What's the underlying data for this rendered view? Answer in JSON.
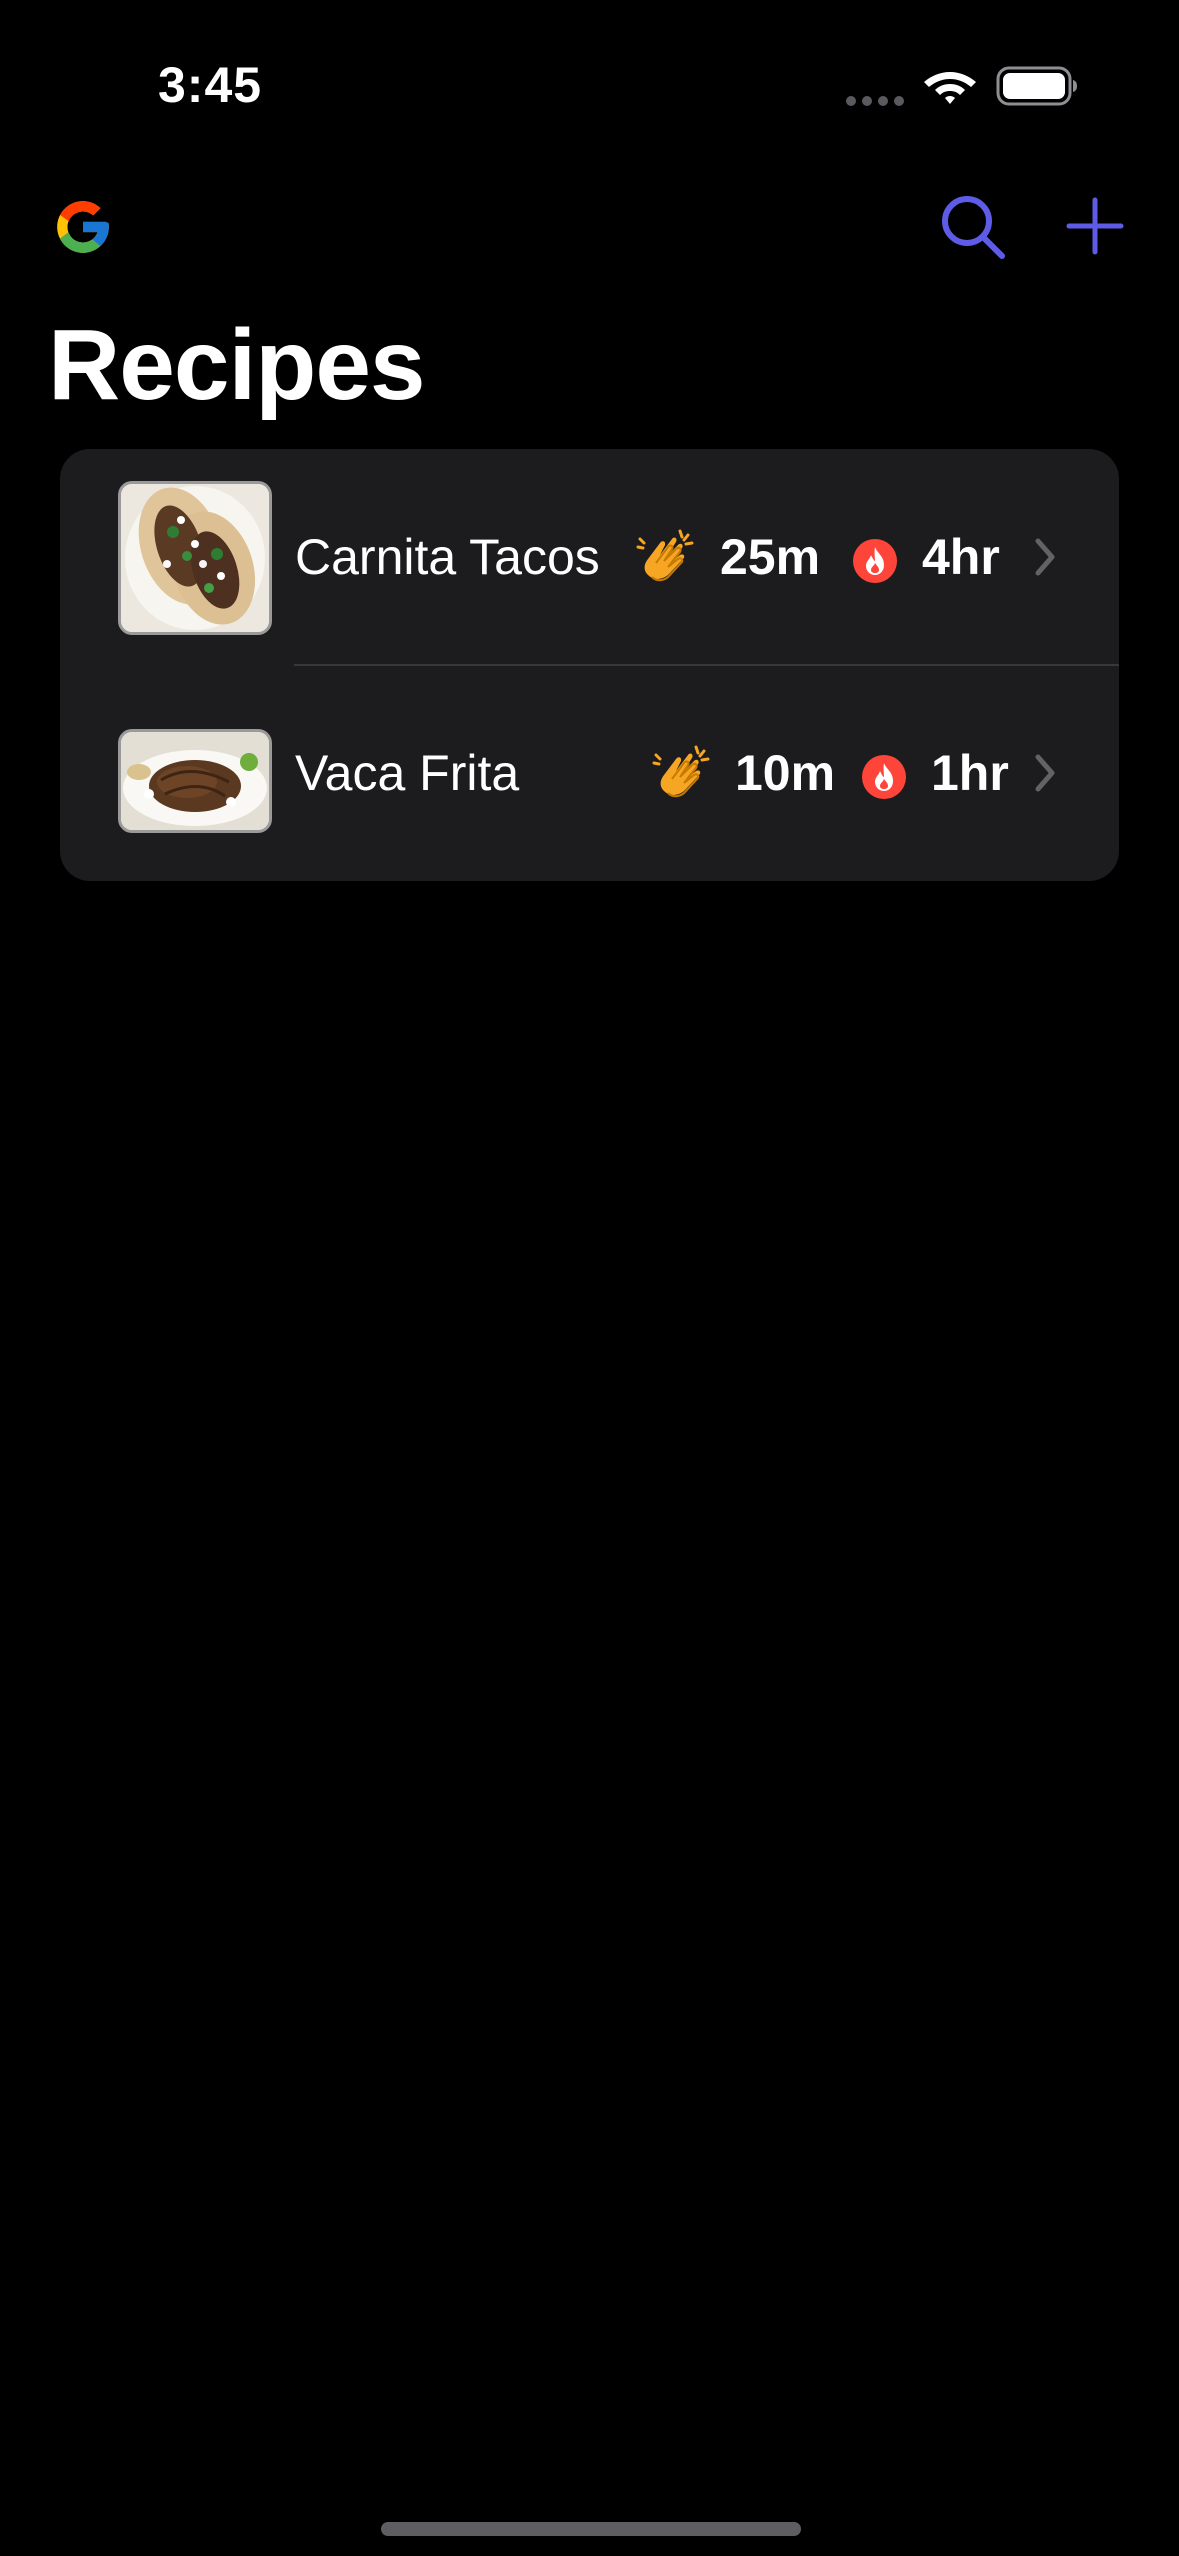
{
  "status_bar": {
    "time": "3:45",
    "icons": [
      "cellular-signal-icon",
      "wifi-icon",
      "battery-icon"
    ]
  },
  "nav_bar": {
    "left_icon": "google-logo-icon",
    "right_icons": [
      "search-icon",
      "add-icon"
    ],
    "accent_color": "#5e5ce6"
  },
  "title": "Recipes",
  "recipes": [
    {
      "name": "Carnita Tacos",
      "prep_icon": "clapping-hands-icon",
      "prep_time": "25m",
      "cook_icon": "fire-icon",
      "cook_time": "4hr",
      "thumbnail": "tacos-thumbnail"
    },
    {
      "name": "Vaca Frita",
      "prep_icon": "clapping-hands-icon",
      "prep_time": "10m",
      "cook_icon": "fire-icon",
      "cook_time": "1hr",
      "thumbnail": "vaca-frita-thumbnail"
    }
  ],
  "colors": {
    "background": "#000000",
    "list_background": "#1c1c1e",
    "clap_color": "#f6a623",
    "fire_color": "#ff453a",
    "chevron_color": "#636366"
  }
}
